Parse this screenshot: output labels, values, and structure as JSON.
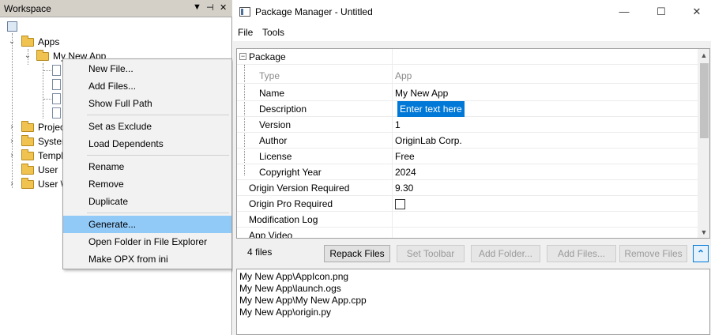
{
  "workspace": {
    "title": "Workspace",
    "pin_icon": "pin-icon",
    "tree": [
      {
        "label": "Apps",
        "expanded": true
      },
      {
        "label": "My New App",
        "expanded": true
      },
      {
        "label": "Projec",
        "expanded": false
      },
      {
        "label": "Syster",
        "expanded": false
      },
      {
        "label": "Templ",
        "expanded": false
      },
      {
        "label": "User",
        "expanded": false
      },
      {
        "label": "User \\",
        "expanded": false
      }
    ]
  },
  "context_menu": {
    "items": [
      "New File...",
      "Add Files...",
      "Show Full Path",
      "Set as Exclude",
      "Load Dependents",
      "Rename",
      "Remove",
      "Duplicate",
      "Generate...",
      "Open Folder in File Explorer",
      "Make OPX from ini"
    ],
    "highlighted": "Generate..."
  },
  "package_manager": {
    "title": "Package Manager - Untitled",
    "window_controls": [
      "—",
      "☐",
      "✕"
    ],
    "menu": [
      "File",
      "Tools"
    ],
    "grid": {
      "section": "Package",
      "rows": [
        {
          "key": "Type",
          "value": "App"
        },
        {
          "key": "Name",
          "value": "My New App"
        },
        {
          "key": "Description",
          "value": "Enter text here"
        },
        {
          "key": "Version",
          "value": "1"
        },
        {
          "key": "Author",
          "value": "OriginLab Corp."
        },
        {
          "key": "License",
          "value": "Free"
        },
        {
          "key": "Copyright Year",
          "value": "2024"
        },
        {
          "key": "Origin Version Required",
          "value": "9.30"
        },
        {
          "key": "Origin Pro Required",
          "value": ""
        },
        {
          "key": "Modification Log",
          "value": ""
        },
        {
          "key": "App Video",
          "value": ""
        }
      ]
    },
    "file_count": "4 files",
    "buttons": {
      "repack": "Repack Files",
      "set_toolbar": "Set Toolbar",
      "add_folder": "Add Folder...",
      "add_files": "Add Files...",
      "remove_files": "Remove Files",
      "collapse": "⌃"
    },
    "files": [
      "My New App\\AppIcon.png",
      "My New App\\launch.ogs",
      "My New App\\My New App.cpp",
      "My New App\\origin.py"
    ]
  }
}
